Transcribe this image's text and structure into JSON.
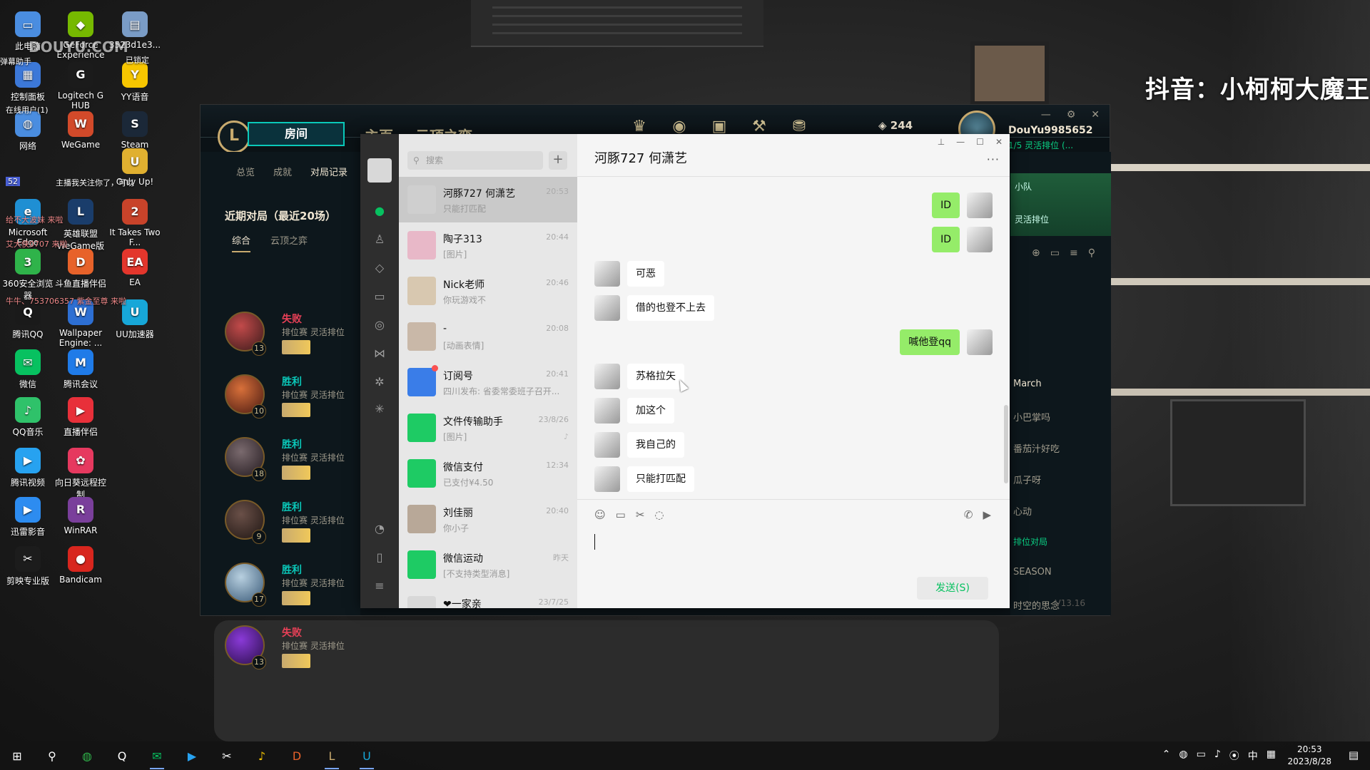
{
  "watermark": "抖音：小柯柯大魔王",
  "desktop": {
    "icons": [
      {
        "label": "此电脑",
        "color": "#4a8de0",
        "glyph": "▭"
      },
      {
        "label": "GeForce Experience",
        "color": "#76b900",
        "glyph": "◆"
      },
      {
        "label": "3523d1e3...",
        "color": "#7a9cc6",
        "glyph": "▤"
      },
      {
        "label": "控制面板",
        "color": "#3c78d8",
        "glyph": "▦"
      },
      {
        "label": "Logitech G HUB",
        "color": "#1b1b1b",
        "glyph": "G"
      },
      {
        "label": "YY语音",
        "color": "#f7c600",
        "glyph": "Y"
      },
      {
        "label": "网络",
        "color": "#4a8de0",
        "glyph": "◍"
      },
      {
        "label": "WeGame",
        "color": "#d24a2a",
        "glyph": "W"
      },
      {
        "label": "Steam",
        "color": "#1b2838",
        "glyph": "S"
      },
      {
        "label": "Only Up!",
        "color": "#e0b030",
        "glyph": "U"
      },
      {
        "label": "Microsoft Edge",
        "color": "#1f8fd3",
        "glyph": "e"
      },
      {
        "label": "英雄联盟WeGame版",
        "color": "#1a3d6b",
        "glyph": "L"
      },
      {
        "label": "It Takes Two F...",
        "color": "#c8432a",
        "glyph": "2"
      },
      {
        "label": "360安全浏览器",
        "color": "#2fb34a",
        "glyph": "3"
      },
      {
        "label": "斗鱼直播伴侣",
        "color": "#e7622a",
        "glyph": "D"
      },
      {
        "label": "EA",
        "color": "#e3362c",
        "glyph": "EA"
      },
      {
        "label": "腾讯QQ",
        "color": "#1a1a1a",
        "glyph": "Q"
      },
      {
        "label": "Wallpaper Engine: ...",
        "color": "#2d6fd3",
        "glyph": "W"
      },
      {
        "label": "UU加速器",
        "color": "#17a7d8",
        "glyph": "U"
      },
      {
        "label": "微信",
        "color": "#07c160",
        "glyph": "✉"
      },
      {
        "label": "腾讯会议",
        "color": "#1f7be8",
        "glyph": "M"
      },
      {
        "label": "QQ音乐",
        "color": "#2fc26a",
        "glyph": "♪"
      },
      {
        "label": "直播伴侣",
        "color": "#e8303a",
        "glyph": "▶"
      },
      {
        "label": "腾讯视频",
        "color": "#27a2f0",
        "glyph": "▶"
      },
      {
        "label": "向日葵远程控制",
        "color": "#e6395f",
        "glyph": "✿"
      },
      {
        "label": "迅雷影音",
        "color": "#2d8cf0",
        "glyph": "▶"
      },
      {
        "label": "WinRAR",
        "color": "#7a3f9b",
        "glyph": "R"
      },
      {
        "label": "剪映专业版",
        "color": "#1c1c1c",
        "glyph": "✂"
      },
      {
        "label": "Bandicam",
        "color": "#d8261e",
        "glyph": "●"
      }
    ],
    "overlay": {
      "brand": "DOUYU.COM",
      "danmu_helper": "弹幕助手",
      "locked": "已锁定",
      "online": "在线用户(1)",
      "lines": [
        "主播我关注你了，可以",
        "给不大波妹 来啦",
        "艾大侠0707 来啦",
        "牛牛、753706357 紫金至尊 来啦"
      ],
      "line_level": "52"
    }
  },
  "lol": {
    "logo": "L",
    "room_button": "房间",
    "nav": [
      "主页",
      "云顶之弈"
    ],
    "currency": "244",
    "username": "DouYu9985652",
    "status": "1/5 灵活排位 (...",
    "left_tabs": [
      "总览",
      "成就",
      "对局记录"
    ],
    "recent_title": "近期对局（最近20场）",
    "recent_tabs": [
      "综合",
      "云顶之弈"
    ],
    "matches": [
      {
        "result": "失败",
        "mode": "排位赛 灵活排位",
        "level": "13",
        "win": false,
        "c1": "#c24a4a",
        "c2": "#3b1b1b"
      },
      {
        "result": "胜利",
        "mode": "排位赛 灵活排位",
        "level": "10",
        "win": true,
        "c1": "#d8703a",
        "c2": "#4a1a12"
      },
      {
        "result": "胜利",
        "mode": "排位赛 灵活排位",
        "level": "18",
        "win": true,
        "c1": "#7a6a6e",
        "c2": "#231a1f"
      },
      {
        "result": "胜利",
        "mode": "排位赛 灵活排位",
        "level": "9",
        "win": true,
        "c1": "#6a5048",
        "c2": "#1f1613"
      },
      {
        "result": "胜利",
        "mode": "排位赛 灵活排位",
        "level": "17",
        "win": true,
        "c1": "#b8d0e0",
        "c2": "#3a5a78"
      },
      {
        "result": "失败",
        "mode": "排位赛 灵活排位",
        "level": "13",
        "win": false,
        "c1": "#8a3ad8",
        "c2": "#2a0f4a"
      }
    ],
    "party_title": "小队",
    "party_mode": "灵活排位",
    "friends": [
      {
        "text": "March",
        "style": "hl"
      },
      {
        "text": "小巴掌吗",
        "style": ""
      },
      {
        "text": "番茄汁好吃",
        "style": ""
      },
      {
        "text": "瓜子呀",
        "style": ""
      },
      {
        "text": "心动",
        "style": ""
      },
      {
        "text": "排位对局",
        "style": "green"
      },
      {
        "text": "SEASON",
        "style": ""
      },
      {
        "text": "时空的思念",
        "style": ""
      }
    ],
    "version": "V13.16"
  },
  "wechat": {
    "search_placeholder": "搜索",
    "chat_title": "河豚727  何潇艺",
    "send_label": "发送(S)",
    "conversations": [
      {
        "name": "河豚727  何潇艺",
        "time": "20:53",
        "preview": "只能打匹配",
        "color": "#cfcfcf",
        "selected": true,
        "dot": false,
        "muted": false
      },
      {
        "name": "陶子313",
        "time": "20:44",
        "preview": "[图片]",
        "color": "#e8b8c8",
        "selected": false,
        "dot": false,
        "muted": false
      },
      {
        "name": "Nick老师",
        "time": "20:46",
        "preview": "你玩游戏不",
        "color": "#d8c8b0",
        "selected": false,
        "dot": false,
        "muted": false
      },
      {
        "name": "-",
        "time": "20:08",
        "preview": "[动画表情]",
        "color": "#c9b8a8",
        "selected": false,
        "dot": false,
        "muted": false
      },
      {
        "name": "订阅号",
        "time": "20:41",
        "preview": "四川发布: 省委常委班子召开...",
        "color": "#3a7de8",
        "selected": false,
        "dot": true,
        "muted": false
      },
      {
        "name": "文件传输助手",
        "time": "23/8/26",
        "preview": "[图片]",
        "color": "#1ecb64",
        "selected": false,
        "dot": false,
        "muted": true
      },
      {
        "name": "微信支付",
        "time": "12:34",
        "preview": "已支付¥4.50",
        "color": "#1ecb64",
        "selected": false,
        "dot": false,
        "muted": false
      },
      {
        "name": "刘佳丽",
        "time": "20:40",
        "preview": "你小子",
        "color": "#b8a898",
        "selected": false,
        "dot": false,
        "muted": false
      },
      {
        "name": "微信运动",
        "time": "昨天",
        "preview": "[不支持类型消息]",
        "color": "#1ecb64",
        "selected": false,
        "dot": false,
        "muted": false
      },
      {
        "name": "❤一家亲",
        "time": "23/7/25",
        "preview": "",
        "color": "#d8d8d8",
        "selected": false,
        "dot": false,
        "muted": false
      }
    ],
    "messages": [
      {
        "dir": "out",
        "text": "ID"
      },
      {
        "dir": "out",
        "text": "ID"
      },
      {
        "dir": "in",
        "text": "可恶"
      },
      {
        "dir": "in",
        "text": "借的也登不上去"
      },
      {
        "dir": "out",
        "text": "喊他登qq"
      },
      {
        "dir": "in",
        "text": "苏格拉矢"
      },
      {
        "dir": "in",
        "text": "加这个"
      },
      {
        "dir": "in",
        "text": "我自己的"
      },
      {
        "dir": "in",
        "text": "只能打匹配"
      }
    ]
  },
  "taskbar": {
    "time": "20:53",
    "date": "2023/8/28",
    "ime": "中",
    "apps": [
      {
        "name": "start",
        "glyph": "⊞",
        "color": "#ffffff",
        "active": false
      },
      {
        "name": "search",
        "glyph": "⚲",
        "color": "#ffffff",
        "active": false
      },
      {
        "name": "360",
        "glyph": "◍",
        "color": "#2fb34a",
        "active": false
      },
      {
        "name": "qq",
        "glyph": "Q",
        "color": "#ffffff",
        "active": false
      },
      {
        "name": "wechat",
        "glyph": "✉",
        "color": "#07c160",
        "active": true
      },
      {
        "name": "tencent-video",
        "glyph": "▶",
        "color": "#27a2f0",
        "active": false
      },
      {
        "name": "capcut",
        "glyph": "✂",
        "color": "#ffffff",
        "active": false
      },
      {
        "name": "qq-music",
        "glyph": "♪",
        "color": "#f7c600",
        "active": false
      },
      {
        "name": "douyu",
        "glyph": "D",
        "color": "#e7622a",
        "active": false
      },
      {
        "name": "league",
        "glyph": "L",
        "color": "#c8aa6e",
        "active": true
      },
      {
        "name": "uu",
        "glyph": "U",
        "color": "#17a7d8",
        "active": true
      }
    ]
  }
}
